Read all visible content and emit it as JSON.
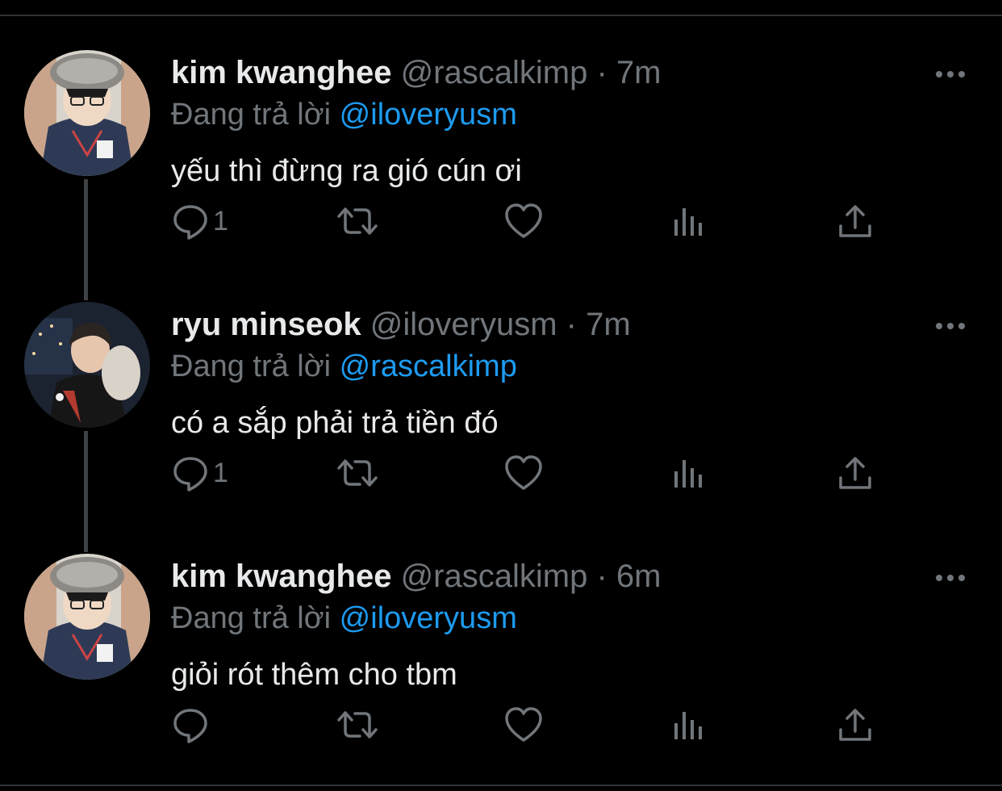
{
  "tweets": [
    {
      "name": "kim kwanghee",
      "handle": "@rascalkimp",
      "separator": "·",
      "time": "7m",
      "reply_label": "Đang trả lời",
      "reply_to": "@iloveryusm",
      "text": "yếu thì đừng ra gió cún ơi",
      "reply_count": "1",
      "avatar": "avatar-kim-kwanghee"
    },
    {
      "name": "ryu minseok",
      "handle": "@iloveryusm",
      "separator": "·",
      "time": "7m",
      "reply_label": "Đang trả lời",
      "reply_to": "@rascalkimp",
      "text": "có a sắp phải trả tiền đó",
      "reply_count": "1",
      "avatar": "avatar-ryu-minseok"
    },
    {
      "name": "kim kwanghee",
      "handle": "@rascalkimp",
      "separator": "·",
      "time": "6m",
      "reply_label": "Đang trả lời",
      "reply_to": "@iloveryusm",
      "text": "giỏi rót thêm cho tbm",
      "reply_count": "",
      "avatar": "avatar-kim-kwanghee"
    }
  ],
  "icons": {
    "reply": "speech-bubble-icon",
    "retweet": "retweet-icon",
    "like": "heart-icon",
    "views": "bar-chart-icon",
    "share": "share-upload-icon",
    "more": "more-dots-icon"
  },
  "colors": {
    "background": "#000000",
    "primary_text": "#e7e9ea",
    "secondary_text": "#71767b",
    "mention": "#1d9bf0"
  }
}
